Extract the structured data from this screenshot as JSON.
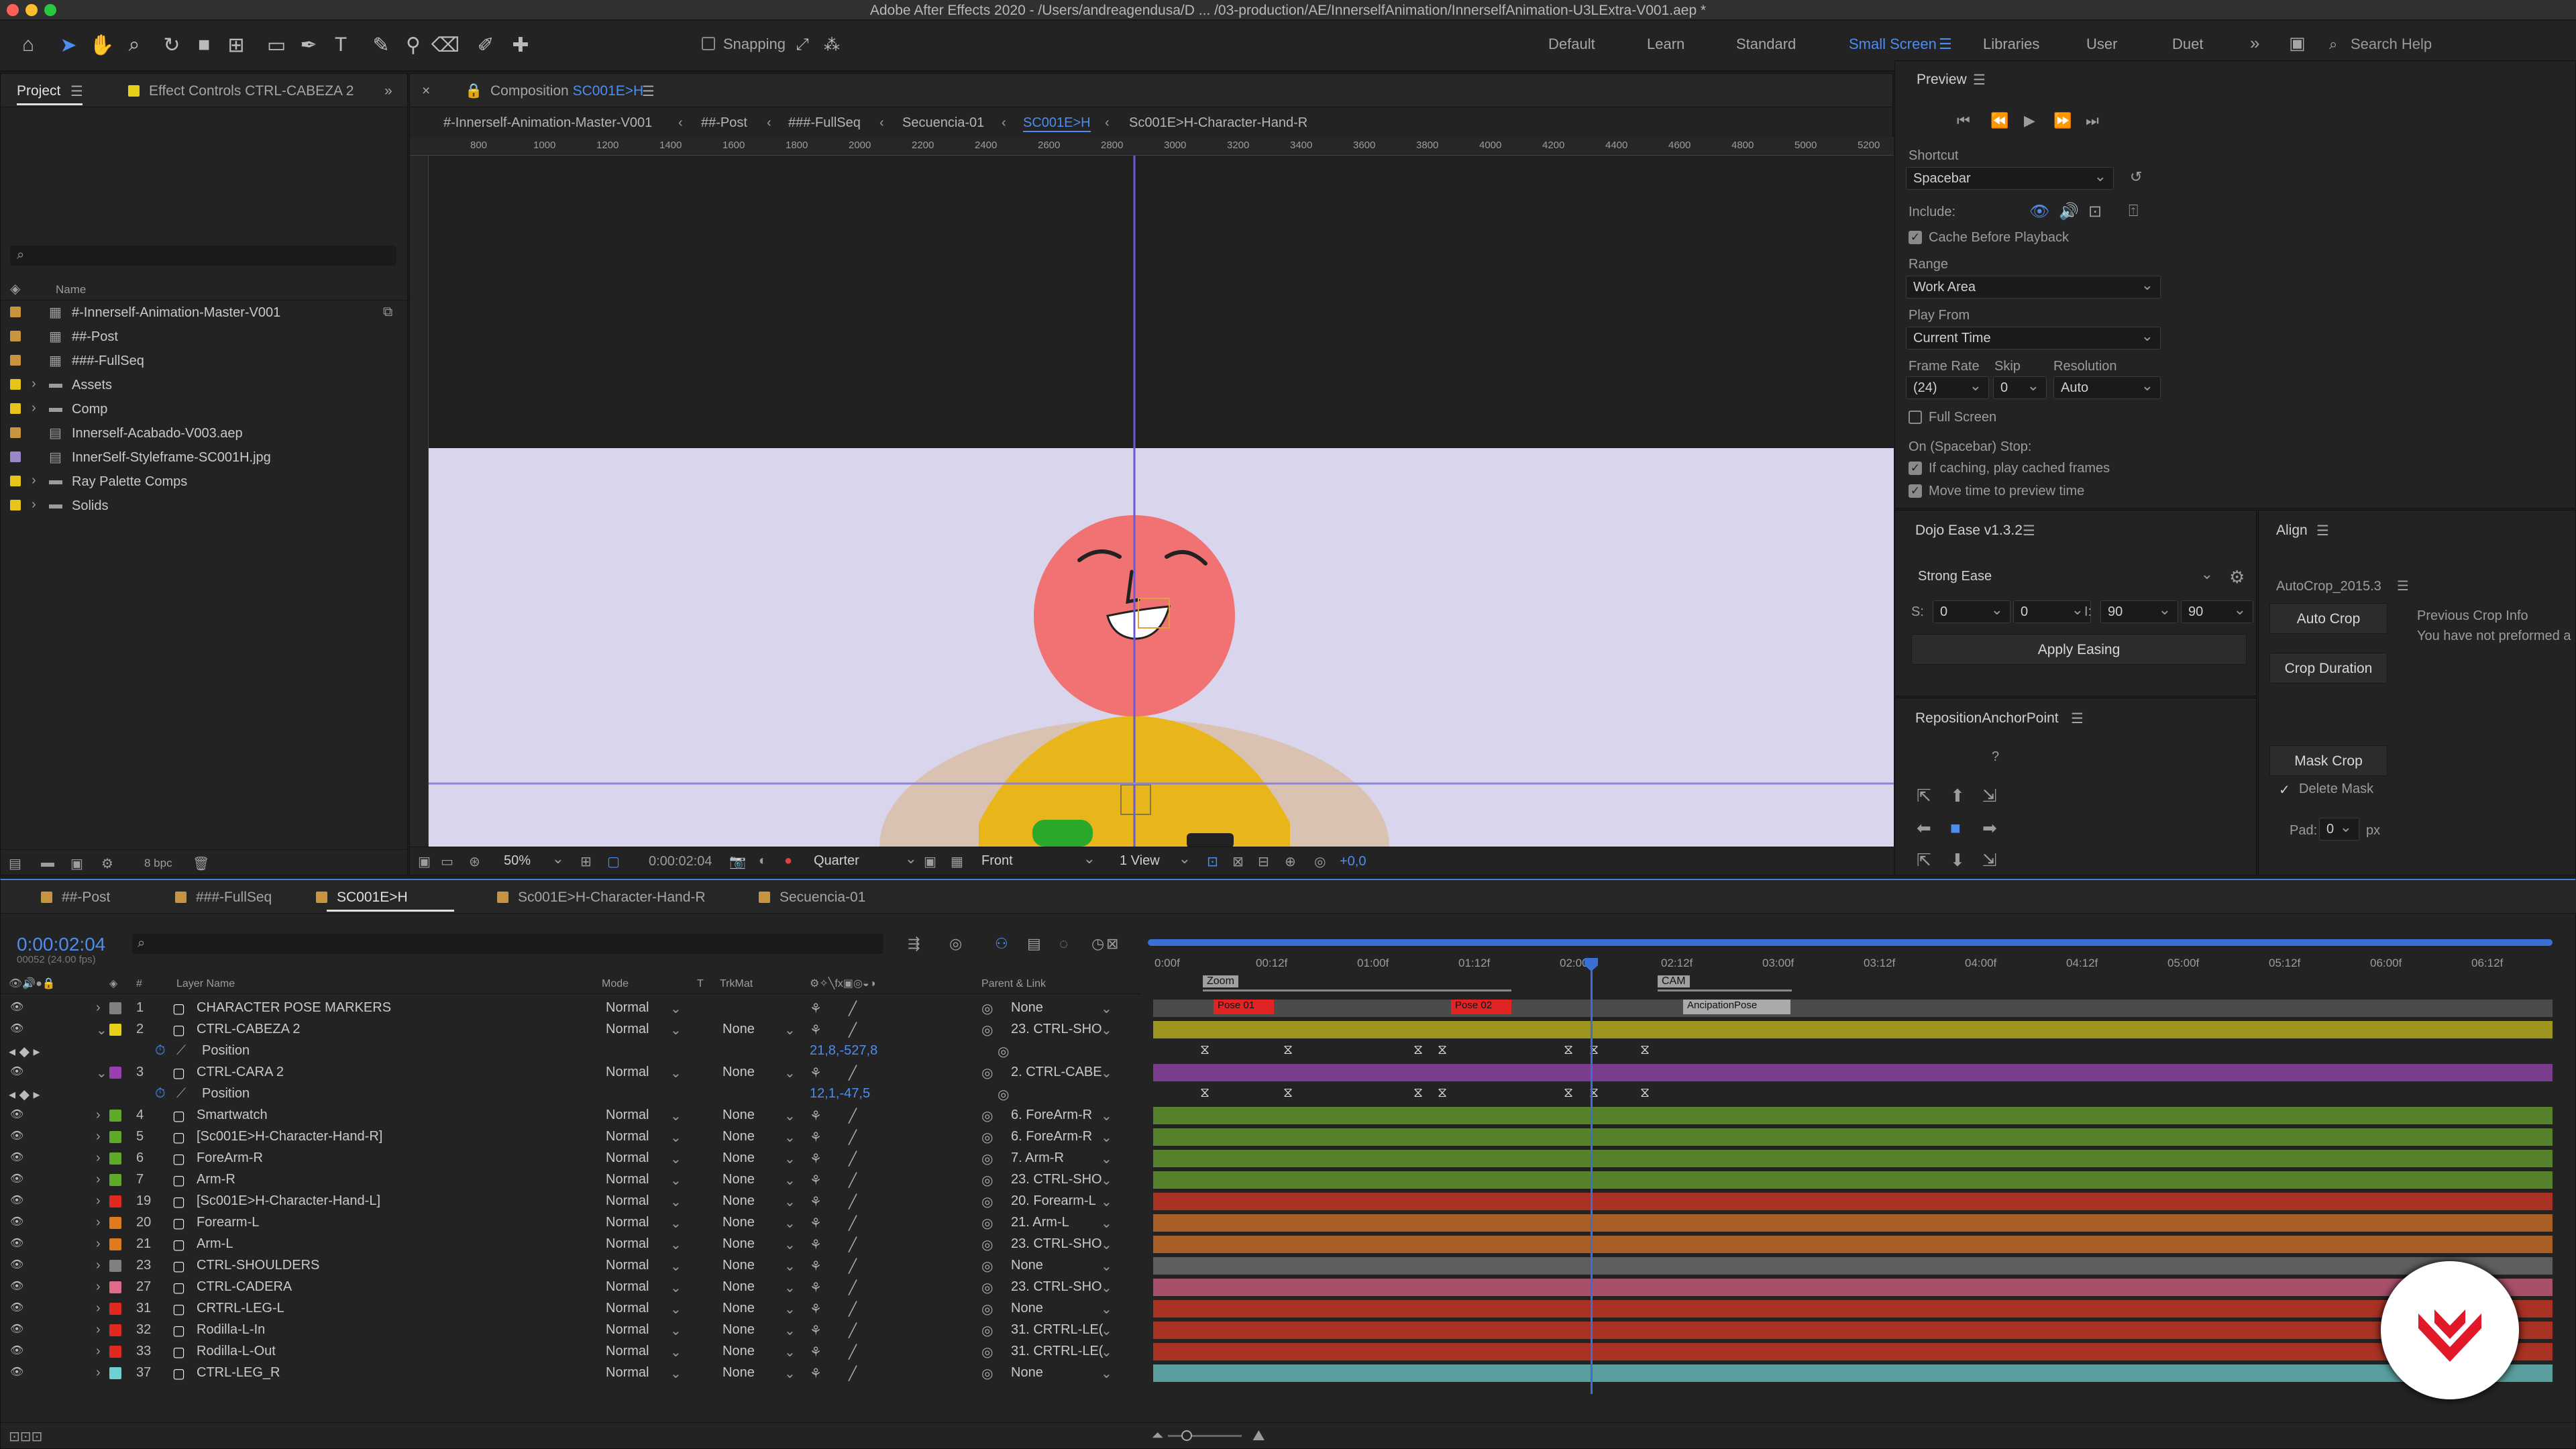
{
  "titlebar": {
    "title": "Adobe After Effects 2020 - /Users/andreagendusa/D ... /03-production/AE/InnerselfAnimation/InnerselfAnimation-U3LExtra-V001.aep *"
  },
  "toolbar": {
    "snapping_label": "Snapping",
    "workspaces": [
      "Default",
      "Learn",
      "Standard",
      "Small Screen",
      "Libraries",
      "User",
      "Duet"
    ],
    "active_workspace": "Small Screen",
    "search_placeholder": "Search Help"
  },
  "project": {
    "tab_label": "Project",
    "effect_controls_label": "Effect Controls CTRL-CABEZA 2",
    "column_name": "Name",
    "bpc": "8 bpc",
    "items": [
      {
        "name": "#-Innerself-Animation-Master-V001",
        "type": "comp",
        "color": "#c8943e"
      },
      {
        "name": "##-Post",
        "type": "comp",
        "color": "#c8943e"
      },
      {
        "name": "###-FullSeq",
        "type": "comp",
        "color": "#c8943e"
      },
      {
        "name": "Assets",
        "type": "folder",
        "color": "#e6c51a"
      },
      {
        "name": "Comp",
        "type": "folder",
        "color": "#e6c51a"
      },
      {
        "name": "Innerself-Acabado-V003.aep",
        "type": "file",
        "color": "#c8943e"
      },
      {
        "name": "InnerSelf-Styleframe-SC001H.jpg",
        "type": "file",
        "color": "#9a86c8"
      },
      {
        "name": "Ray Palette Comps",
        "type": "folder",
        "color": "#e6c51a"
      },
      {
        "name": "Solids",
        "type": "folder",
        "color": "#e6c51a"
      }
    ]
  },
  "composition": {
    "tab_label": "Composition",
    "comp_name": "SC001E>H",
    "breadcrumbs": [
      "#-Innerself-Animation-Master-V001",
      "##-Post",
      "###-FullSeq",
      "Secuencia-01",
      "SC001E>H",
      "Sc001E>H-Character-Hand-R"
    ],
    "ruler_ticks": [
      "800",
      "1000",
      "1200",
      "1400",
      "1600",
      "1800",
      "2000",
      "2200",
      "2400",
      "2600",
      "2800",
      "3000",
      "3200",
      "3400",
      "3600",
      "3800",
      "4000",
      "4200",
      "4400",
      "4600",
      "4800",
      "5000",
      "5200"
    ],
    "zoom": "50%",
    "timecode": "0:00:02:04",
    "resolution": "Quarter",
    "view": "Front",
    "views": "1 View",
    "exposure": "+0,0"
  },
  "preview": {
    "title": "Preview",
    "shortcut_label": "Shortcut",
    "shortcut_value": "Spacebar",
    "include_label": "Include:",
    "cache_label": "Cache Before Playback",
    "range_label": "Range",
    "range_value": "Work Area",
    "play_from_label": "Play From",
    "play_from_value": "Current Time",
    "frame_rate_label": "Frame Rate",
    "frame_rate_value": "(24)",
    "skip_label": "Skip",
    "skip_value": "0",
    "resolution_label": "Resolution",
    "resolution_value": "Auto",
    "full_screen_label": "Full Screen",
    "on_stop_label": "On (Spacebar) Stop:",
    "if_caching_label": "If caching, play cached frames",
    "move_time_label": "Move time to preview time"
  },
  "dojo": {
    "title": "Dojo Ease v1.3.2",
    "ease_value": "Strong Ease",
    "s_label": "S:",
    "s1": "0",
    "s2": "0",
    "i_label": "I:",
    "i1": "90",
    "i2": "90",
    "apply_label": "Apply Easing"
  },
  "align": {
    "title": "Align",
    "autocrop_title": "AutoCrop_2015.3",
    "auto_crop": "Auto Crop",
    "crop_duration": "Crop Duration",
    "previous_crop_title": "Previous Crop Info",
    "previous_crop_text": "You have not preformed a",
    "mask_crop": "Mask Crop",
    "delete_mask": "Delete Mask",
    "pad_label": "Pad:",
    "pad_value": "0",
    "pad_unit": "px"
  },
  "reposition": {
    "title": "RepositionAnchorPoint",
    "help": "?"
  },
  "timeline": {
    "tabs": [
      "##-Post",
      "###-FullSeq",
      "SC001E>H",
      "Sc001E>H-Character-Hand-R",
      "Secuencia-01"
    ],
    "active_tab": "SC001E>H",
    "timecode": "0:00:02:04",
    "frame_info": "00052 (24.00 fps)",
    "columns": {
      "layer_name": "Layer Name",
      "mode": "Mode",
      "t": "T",
      "trkmat": "TrkMat",
      "parent": "Parent & Link"
    },
    "ruler": [
      "0:00f",
      "00:12f",
      "01:00f",
      "01:12f",
      "02:00f",
      "02:12f",
      "03:00f",
      "03:12f",
      "04:00f",
      "04:12f",
      "05:00f",
      "05:12f",
      "06:00f",
      "06:12f"
    ],
    "markers": {
      "work_area_1": "Zoom",
      "work_area_2": "CAM",
      "pose1": "Pose 01",
      "pose2": "Pose 02",
      "anticipation": "AncipationPose"
    },
    "layers": [
      {
        "num": "1",
        "name": "CHARACTER POSE MARKERS",
        "mode": "Normal",
        "trkmat": "",
        "parent": "None",
        "color": "#808080",
        "bar": "#4b4b4b"
      },
      {
        "num": "2",
        "name": "CTRL-CABEZA 2",
        "mode": "Normal",
        "trkmat": "None",
        "parent": "23. CTRL-SHO",
        "color": "#e6d11a",
        "bar": "#9e9420",
        "prop": "Position",
        "prop_value": "21,8,-527,8"
      },
      {
        "num": "3",
        "name": "CTRL-CARA 2",
        "mode": "Normal",
        "trkmat": "None",
        "parent": "2. CTRL-CABE",
        "color": "#9a3fb0",
        "bar": "#7a3c8c",
        "prop": "Position",
        "prop_value": "12,1,-47,5"
      },
      {
        "num": "4",
        "name": "Smartwatch",
        "mode": "Normal",
        "trkmat": "None",
        "parent": "6. ForeArm-R",
        "color": "#5fa82a",
        "bar": "#56822b"
      },
      {
        "num": "5",
        "name": "[Sc001E>H-Character-Hand-R]",
        "mode": "Normal",
        "trkmat": "None",
        "parent": "6. ForeArm-R",
        "color": "#5fa82a",
        "bar": "#56822b"
      },
      {
        "num": "6",
        "name": "ForeArm-R",
        "mode": "Normal",
        "trkmat": "None",
        "parent": "7. Arm-R",
        "color": "#5fa82a",
        "bar": "#56822b"
      },
      {
        "num": "7",
        "name": "Arm-R",
        "mode": "Normal",
        "trkmat": "None",
        "parent": "23. CTRL-SHO",
        "color": "#5fa82a",
        "bar": "#56822b"
      },
      {
        "num": "19",
        "name": "[Sc001E>H-Character-Hand-L]",
        "mode": "Normal",
        "trkmat": "None",
        "parent": "20. Forearm-L",
        "color": "#e0291e",
        "bar": "#a83224"
      },
      {
        "num": "20",
        "name": "Forearm-L",
        "mode": "Normal",
        "trkmat": "None",
        "parent": "21. Arm-L",
        "color": "#e07a1e",
        "bar": "#a85e24"
      },
      {
        "num": "21",
        "name": "Arm-L",
        "mode": "Normal",
        "trkmat": "None",
        "parent": "23. CTRL-SHO",
        "color": "#e07a1e",
        "bar": "#a85e24"
      },
      {
        "num": "23",
        "name": "CTRL-SHOULDERS",
        "mode": "Normal",
        "trkmat": "None",
        "parent": "None",
        "color": "#808080",
        "bar": "#5e5e5e"
      },
      {
        "num": "27",
        "name": "CTRL-CADERA",
        "mode": "Normal",
        "trkmat": "None",
        "parent": "23. CTRL-SHO",
        "color": "#e06a8a",
        "bar": "#a8506a"
      },
      {
        "num": "31",
        "name": "CRTRL-LEG-L",
        "mode": "Normal",
        "trkmat": "None",
        "parent": "None",
        "color": "#e0291e",
        "bar": "#a83224"
      },
      {
        "num": "32",
        "name": "Rodilla-L-In",
        "mode": "Normal",
        "trkmat": "None",
        "parent": "31. CRTRL-LE(",
        "color": "#e0291e",
        "bar": "#a83224"
      },
      {
        "num": "33",
        "name": "Rodilla-L-Out",
        "mode": "Normal",
        "trkmat": "None",
        "parent": "31. CRTRL-LE(",
        "color": "#e0291e",
        "bar": "#a83224"
      },
      {
        "num": "37",
        "name": "CTRL-LEG_R",
        "mode": "Normal",
        "trkmat": "None",
        "parent": "None",
        "color": "#6ed0d0",
        "bar": "#5a9e9e"
      }
    ]
  }
}
